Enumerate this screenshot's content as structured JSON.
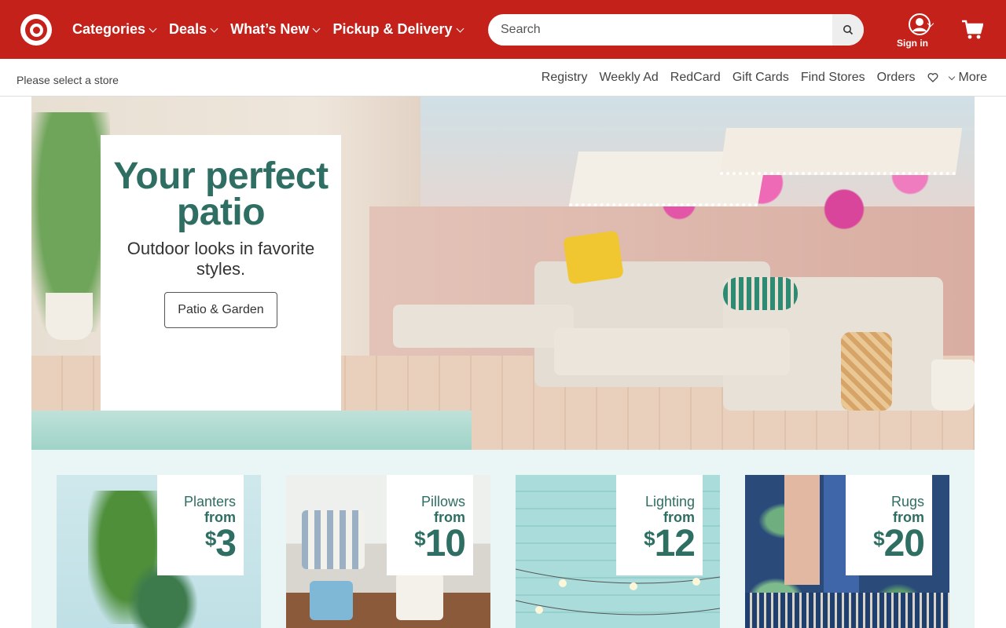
{
  "header": {
    "brand": "Target",
    "nav": [
      {
        "label": "Categories"
      },
      {
        "label": "Deals"
      },
      {
        "label": "What’s New"
      },
      {
        "label": "Pickup & Delivery"
      }
    ],
    "search": {
      "placeholder": "Search",
      "icon": "search-icon"
    },
    "account": {
      "label": "Sign in",
      "icon": "user-icon"
    },
    "cart": {
      "icon": "cart-icon"
    },
    "accent": "#c4211b"
  },
  "subbar": {
    "store": "Please select a store",
    "links": [
      "Registry",
      "Weekly Ad",
      "RedCard",
      "Gift Cards",
      "Find Stores",
      "Orders"
    ],
    "favorites_icon": "heart-icon",
    "more": "More"
  },
  "hero": {
    "title": "Your perfect patio",
    "subtitle": "Outdoor looks in favorite styles.",
    "cta": "Patio & Garden",
    "title_color": "#2f6e62"
  },
  "deals": [
    {
      "category": "Planters",
      "from": "from",
      "currency": "$",
      "price": "3"
    },
    {
      "category": "Pillows",
      "from": "from",
      "currency": "$",
      "price": "10"
    },
    {
      "category": "Lighting",
      "from": "from",
      "currency": "$",
      "price": "12"
    },
    {
      "category": "Rugs",
      "from": "from",
      "currency": "$",
      "price": "20"
    }
  ]
}
